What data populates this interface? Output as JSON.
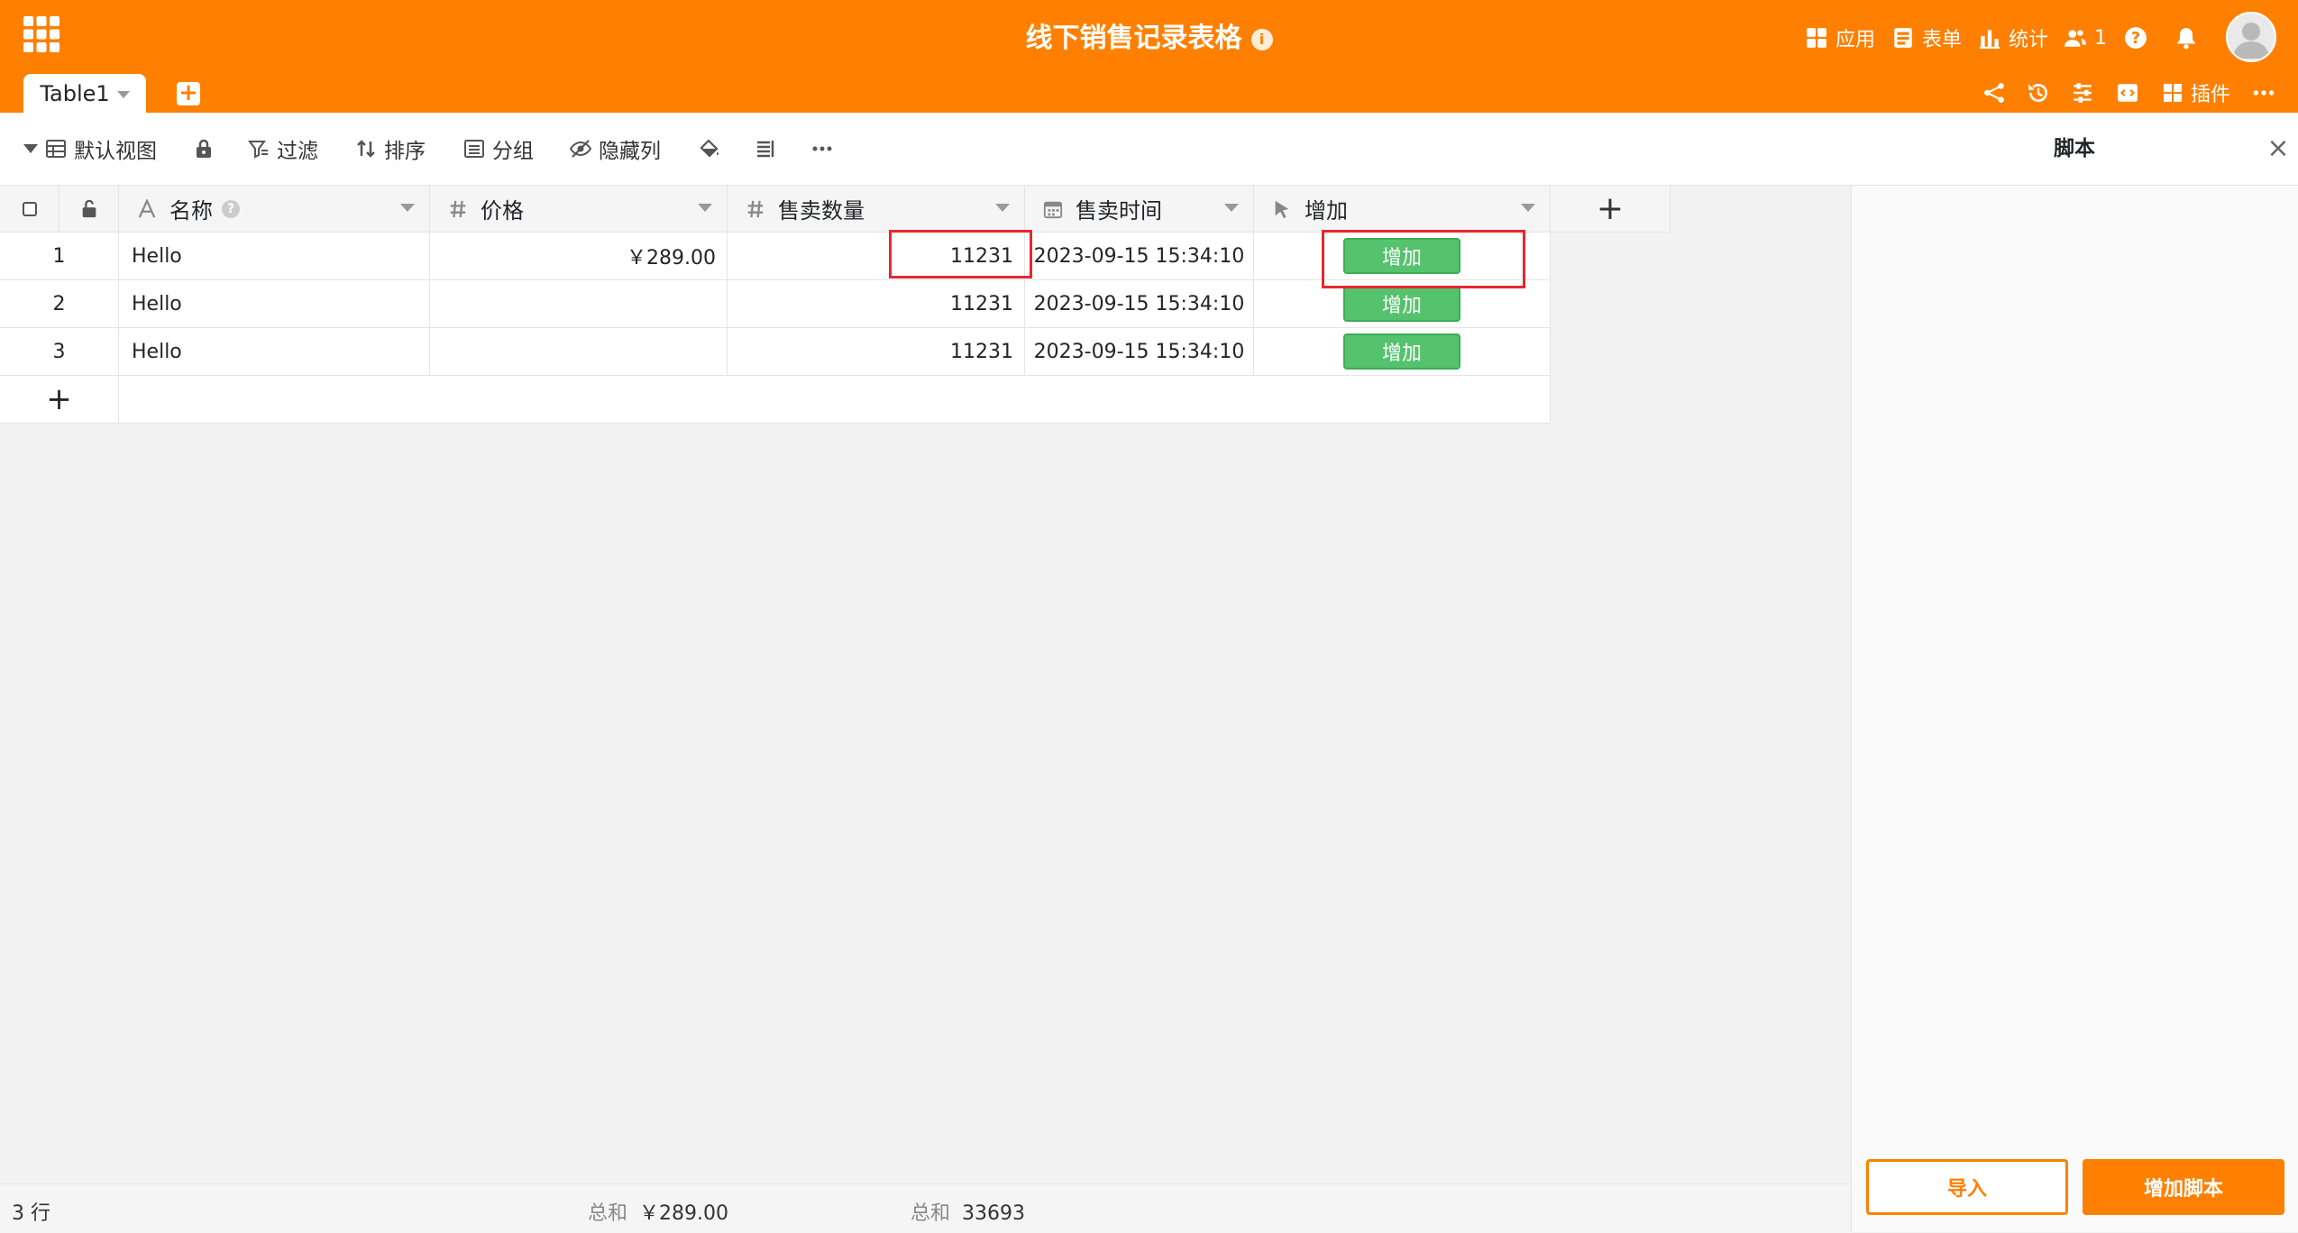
{
  "header": {
    "title": "线下销售记录表格",
    "apps_label": "应用",
    "forms_label": "表单",
    "stats_label": "统计",
    "collaborators_count": "1",
    "plugins_label": "插件",
    "accent_color": "#ff8000"
  },
  "tabs": [
    {
      "label": "Table1"
    }
  ],
  "toolbar": {
    "view_label": "默认视图",
    "filter_label": "过滤",
    "sort_label": "排序",
    "group_label": "分组",
    "hide_columns_label": "隐藏列"
  },
  "table": {
    "columns": [
      {
        "label": "名称",
        "icon": "text-icon"
      },
      {
        "label": "价格",
        "icon": "number-icon"
      },
      {
        "label": "售卖数量",
        "icon": "number-icon"
      },
      {
        "label": "售卖时间",
        "icon": "calendar-icon"
      },
      {
        "label": "增加",
        "icon": "cursor-icon"
      }
    ],
    "rows": [
      {
        "num": "1",
        "name": "Hello",
        "price": "￥289.00",
        "qty": "11231",
        "time": "2023-09-15 15:34:10",
        "button": "增加"
      },
      {
        "num": "2",
        "name": "Hello",
        "price": "",
        "qty": "11231",
        "time": "2023-09-15 15:34:10",
        "button": "增加"
      },
      {
        "num": "3",
        "name": "Hello",
        "price": "",
        "qty": "11231",
        "time": "2023-09-15 15:34:10",
        "button": "增加"
      }
    ],
    "add_row_symbol": "+",
    "add_column_symbol": "+",
    "button_color": "#55c26d"
  },
  "footer": {
    "row_count": "3 行",
    "price_sum_label": "总和",
    "price_sum_value": "￥289.00",
    "qty_sum_label": "总和",
    "qty_sum_value": "33693"
  },
  "script_panel": {
    "title": "脚本",
    "import_label": "导入",
    "add_script_label": "增加脚本"
  }
}
